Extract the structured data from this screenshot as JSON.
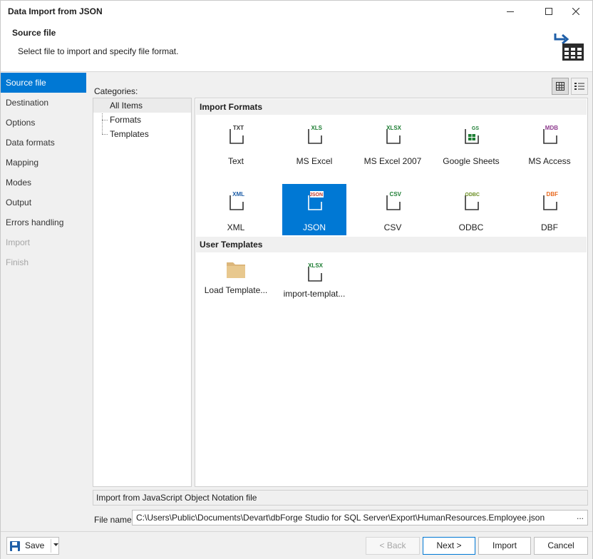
{
  "window": {
    "title": "Data Import from JSON"
  },
  "header": {
    "title": "Source file",
    "subtitle": "Select file to import and specify file format."
  },
  "nav": {
    "items": [
      {
        "label": "Source file",
        "state": "active"
      },
      {
        "label": "Destination",
        "state": "normal"
      },
      {
        "label": "Options",
        "state": "normal"
      },
      {
        "label": "Data formats",
        "state": "normal"
      },
      {
        "label": "Mapping",
        "state": "normal"
      },
      {
        "label": "Modes",
        "state": "normal"
      },
      {
        "label": "Output",
        "state": "normal"
      },
      {
        "label": "Errors handling",
        "state": "normal"
      },
      {
        "label": "Import",
        "state": "disabled"
      },
      {
        "label": "Finish",
        "state": "disabled"
      }
    ]
  },
  "categories": {
    "label": "Categories:",
    "items": [
      "All Items",
      "Formats",
      "Templates"
    ]
  },
  "gallery": {
    "import_formats_header": "Import Formats",
    "formats": [
      {
        "label": "Text",
        "badge": "TXT",
        "color": "#333333"
      },
      {
        "label": "MS Excel",
        "badge": "XLS",
        "color": "#1e7e34"
      },
      {
        "label": "MS Excel 2007",
        "badge": "XLSX",
        "color": "#1e7e34"
      },
      {
        "label": "Google Sheets",
        "badge": "GS",
        "color": "#1e7e34"
      },
      {
        "label": "MS Access",
        "badge": "MDB",
        "color": "#8e3a8e"
      },
      {
        "label": "XML",
        "badge": "XML",
        "color": "#1f5fa8"
      },
      {
        "label": "JSON",
        "badge": "JSON",
        "color": "#c0392b"
      },
      {
        "label": "CSV",
        "badge": "CSV",
        "color": "#1e7e34"
      },
      {
        "label": "ODBC",
        "badge": "ODBC",
        "color": "#6b8e23"
      },
      {
        "label": "DBF",
        "badge": "DBF",
        "color": "#e8691e"
      }
    ],
    "selected_format": "JSON",
    "user_templates_header": "User Templates",
    "templates": [
      {
        "label": "Load Template...",
        "icon": "folder-icon"
      },
      {
        "label": "import-templat...",
        "badge": "XLSX",
        "color": "#1e7e34"
      }
    ]
  },
  "description": "Import from JavaScript Object Notation file",
  "file_name": {
    "label": "File name:",
    "value": "C:\\Users\\Public\\Documents\\Devart\\dbForge Studio for SQL Server\\Export\\HumanResources.Employee.json",
    "browse": "..."
  },
  "footer": {
    "save": "Save",
    "back": "< Back",
    "next": "Next >",
    "import": "Import",
    "cancel": "Cancel"
  },
  "colors": {
    "accent": "#0078d4"
  }
}
